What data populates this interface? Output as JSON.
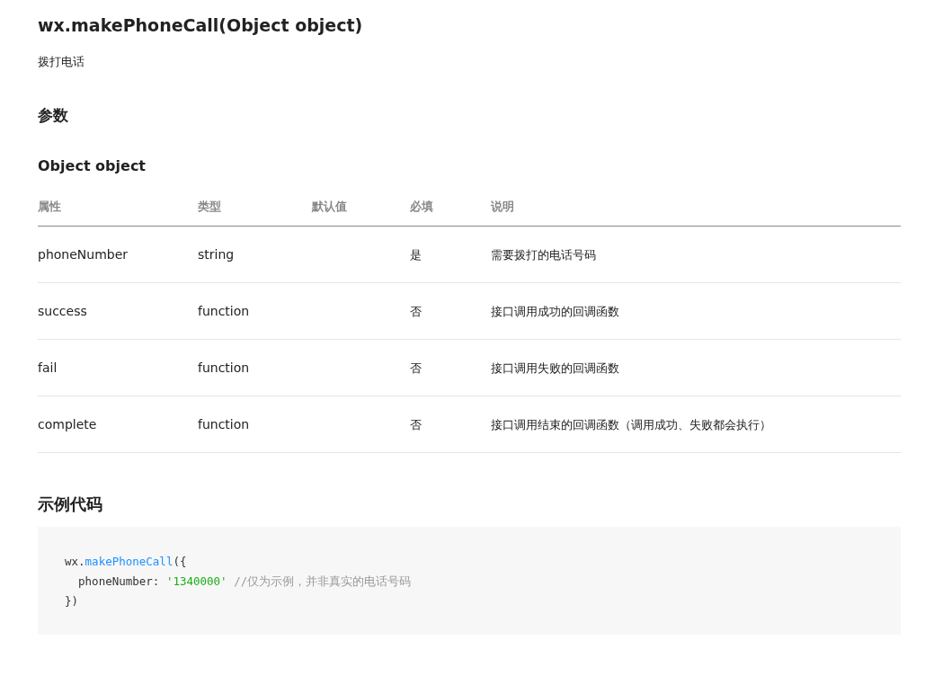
{
  "title": "wx.makePhoneCall(Object object)",
  "description": "拨打电话",
  "params_heading": "参数",
  "object_heading": "Object object",
  "table": {
    "columns": [
      "属性",
      "类型",
      "默认值",
      "必填",
      "说明"
    ],
    "rows": [
      [
        "phoneNumber",
        "string",
        "",
        "是",
        "需要拨打的电话号码"
      ],
      [
        "success",
        "function",
        "",
        "否",
        "接口调用成功的回调函数"
      ],
      [
        "fail",
        "function",
        "",
        "否",
        "接口调用失败的回调函数"
      ],
      [
        "complete",
        "function",
        "",
        "否",
        "接口调用结束的回调函数（调用成功、失败都会执行）"
      ]
    ]
  },
  "example_heading": "示例代码",
  "code_lines": [
    [
      {
        "kind": "plain",
        "text": "wx."
      },
      {
        "kind": "function",
        "text": "makePhoneCall"
      },
      {
        "kind": "plain",
        "text": "({"
      }
    ],
    [
      {
        "kind": "plain",
        "text": "  phoneNumber: "
      },
      {
        "kind": "string",
        "text": "'1340000'"
      },
      {
        "kind": "comment",
        "text": "//仅为示例，并非真实的电话号码"
      }
    ],
    [
      {
        "kind": "plain",
        "text": "})"
      }
    ]
  ]
}
